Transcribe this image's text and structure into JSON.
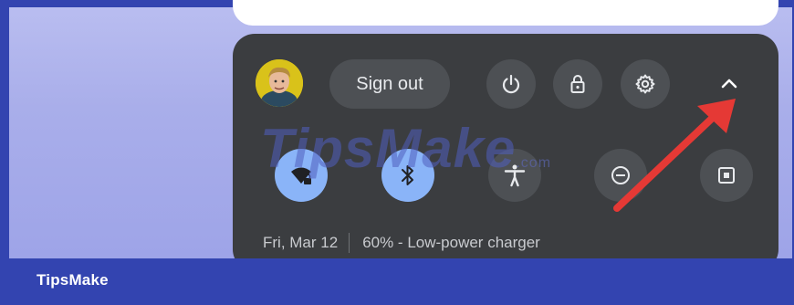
{
  "user_menu": {
    "sign_out_label": "Sign out",
    "buttons": [
      {
        "name": "power-icon"
      },
      {
        "name": "lock-icon"
      },
      {
        "name": "gear-icon"
      },
      {
        "name": "chevron-up-icon"
      }
    ]
  },
  "quick_tiles": [
    {
      "name": "wifi-tile",
      "icon": "wifi-lock-icon",
      "state": "on"
    },
    {
      "name": "bluetooth-tile",
      "icon": "bluetooth-icon",
      "state": "on"
    },
    {
      "name": "accessibility-tile",
      "icon": "accessibility-icon",
      "state": "off"
    },
    {
      "name": "do-not-disturb-tile",
      "icon": "minus-circle-icon",
      "state": "off"
    },
    {
      "name": "screen-capture-tile",
      "icon": "screen-capture-icon",
      "state": "off"
    }
  ],
  "status_bar": {
    "date": "Fri, Mar 12",
    "battery": "60% - Low-power charger"
  },
  "watermark": {
    "text": "TipsMake",
    "suffix": ".com"
  },
  "footer": {
    "label": "TipsMake"
  },
  "colors": {
    "accent": "#8ab4f8",
    "panel": "#3b3d40",
    "button": "#4d5054",
    "annotation_arrow": "#e53935",
    "footer": "#3344b0"
  }
}
